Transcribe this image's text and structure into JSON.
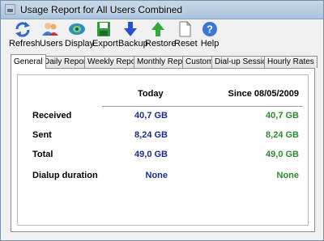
{
  "window": {
    "title": "Usage Report for All Users Combined"
  },
  "toolbar": {
    "buttons": [
      {
        "label": "Refresh",
        "icon": "refresh-icon"
      },
      {
        "label": "Users",
        "icon": "users-icon"
      },
      {
        "label": "Display",
        "icon": "display-icon"
      },
      {
        "label": "Export",
        "icon": "export-icon"
      },
      {
        "label": "Backup",
        "icon": "backup-icon"
      },
      {
        "label": "Restore",
        "icon": "restore-icon"
      },
      {
        "label": "Reset",
        "icon": "reset-icon"
      },
      {
        "label": "Help",
        "icon": "help-icon"
      }
    ]
  },
  "tabs": [
    {
      "label": "General",
      "active": true
    },
    {
      "label": "Daily Report"
    },
    {
      "label": "Weekly Report"
    },
    {
      "label": "Monthly Report"
    },
    {
      "label": "Custom"
    },
    {
      "label": "Dial-up Sessions"
    },
    {
      "label": "Hourly Rates"
    }
  ],
  "report": {
    "col_today": "Today",
    "col_since": "Since 08/05/2009",
    "rows": [
      {
        "label": "Received",
        "today": "40,7 GB",
        "since": "40,7 GB"
      },
      {
        "label": "Sent",
        "today": "8,24 GB",
        "since": "8,24 GB"
      },
      {
        "label": "Total",
        "today": "49,0 GB",
        "since": "49,0 GB"
      },
      {
        "label": "Dialup duration",
        "today": "None",
        "since": "None"
      }
    ]
  },
  "colors": {
    "today": "#1a2d8f",
    "since": "#2e8b2e"
  }
}
